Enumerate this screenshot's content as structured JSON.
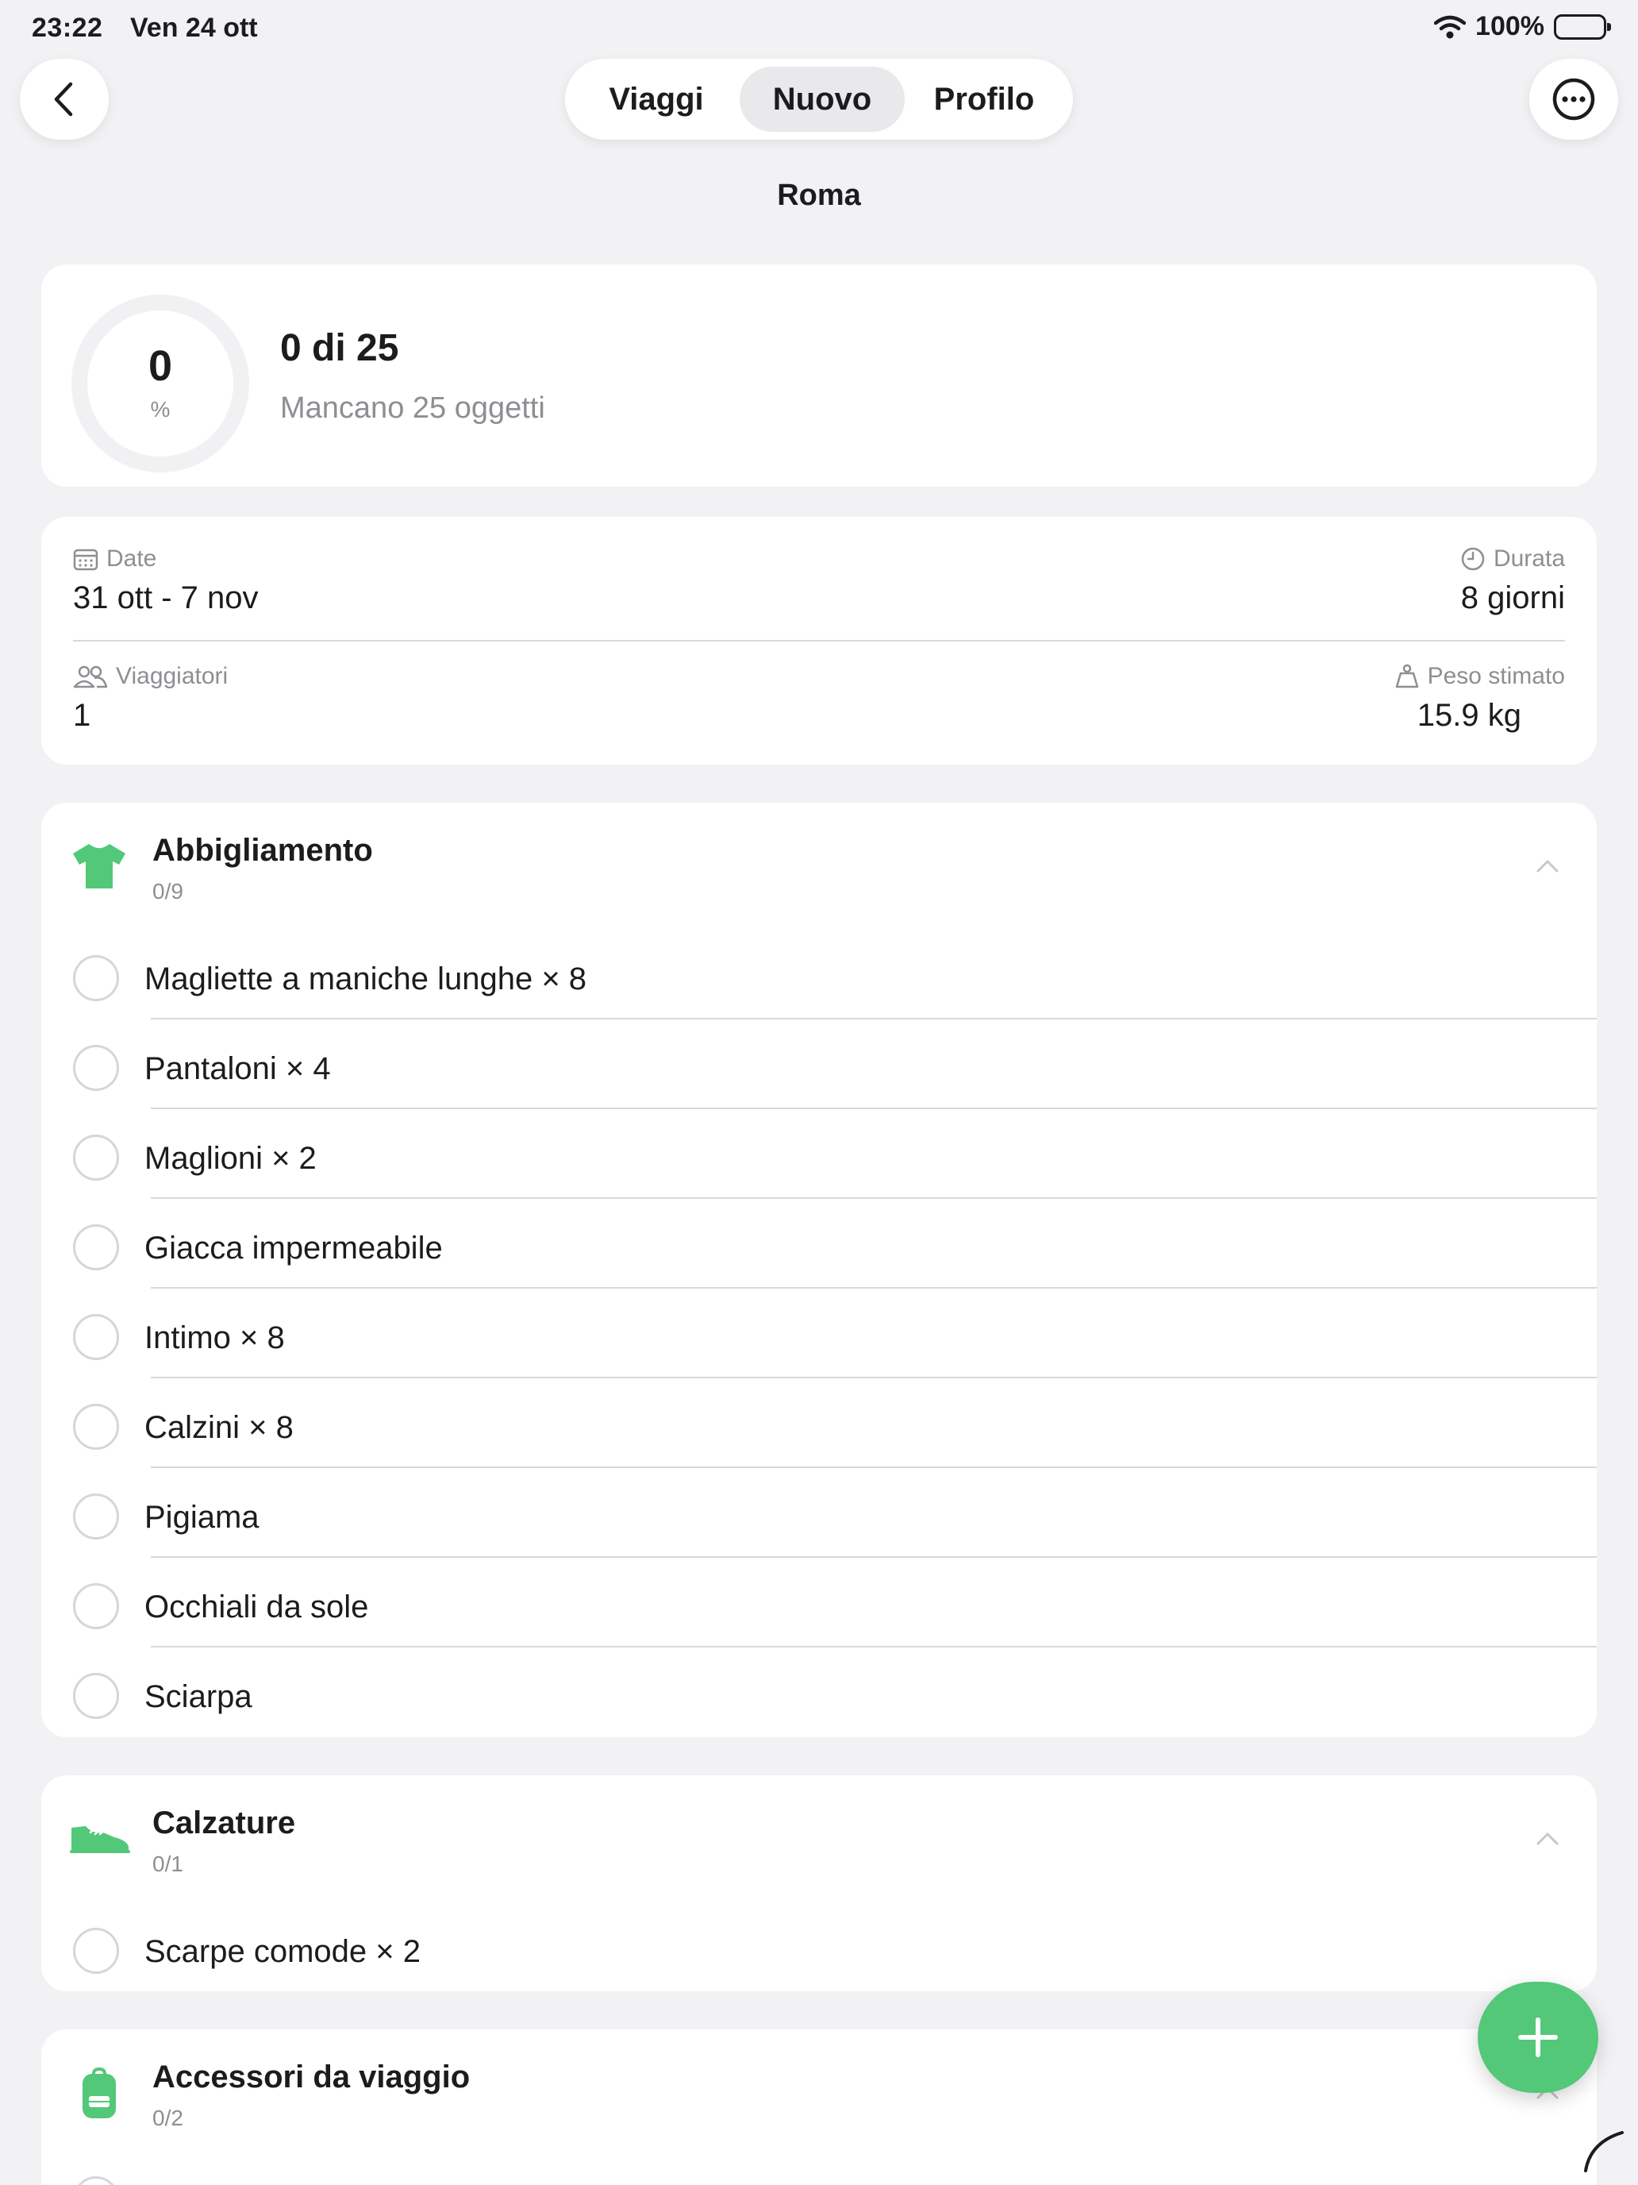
{
  "status_bar": {
    "time": "23:22",
    "date": "Ven 24 ott",
    "battery": "100%"
  },
  "nav": {
    "tabs": [
      {
        "label": "Viaggi"
      },
      {
        "label": "Nuovo"
      },
      {
        "label": "Profilo"
      }
    ],
    "selected_tab": "Nuovo"
  },
  "trip": {
    "title": "Roma"
  },
  "progress": {
    "value": "0",
    "unit": "%",
    "count": "0 di 25",
    "remaining": "Mancano 25 oggetti"
  },
  "info": {
    "dates_label": "Date",
    "dates_value": "31 ott - 7 nov",
    "duration_label": "Durata",
    "duration_value": "8 giorni",
    "travelers_label": "Viaggiatori",
    "travelers_value": "1",
    "weight_label": "Peso stimato",
    "weight_value": "15.9 kg"
  },
  "categories": [
    {
      "title": "Abbigliamento",
      "count": "0/9",
      "icon": "tshirt-icon",
      "items": [
        {
          "label": "Magliette a maniche lunghe × 8"
        },
        {
          "label": "Pantaloni × 4"
        },
        {
          "label": "Maglioni × 2"
        },
        {
          "label": "Giacca impermeabile"
        },
        {
          "label": "Intimo × 8"
        },
        {
          "label": "Calzini × 8"
        },
        {
          "label": "Pigiama"
        },
        {
          "label": "Occhiali da sole"
        },
        {
          "label": "Sciarpa"
        }
      ]
    },
    {
      "title": "Calzature",
      "count": "0/1",
      "icon": "shoe-icon",
      "items": [
        {
          "label": "Scarpe comode × 2"
        }
      ]
    },
    {
      "title": "Accessori da viaggio",
      "count": "0/2",
      "icon": "backpack-icon",
      "items": []
    }
  ],
  "colors": {
    "accent": "#52c878",
    "background": "#f2f2f4",
    "card": "#ffffff",
    "secondary_text": "#8e8e93"
  }
}
